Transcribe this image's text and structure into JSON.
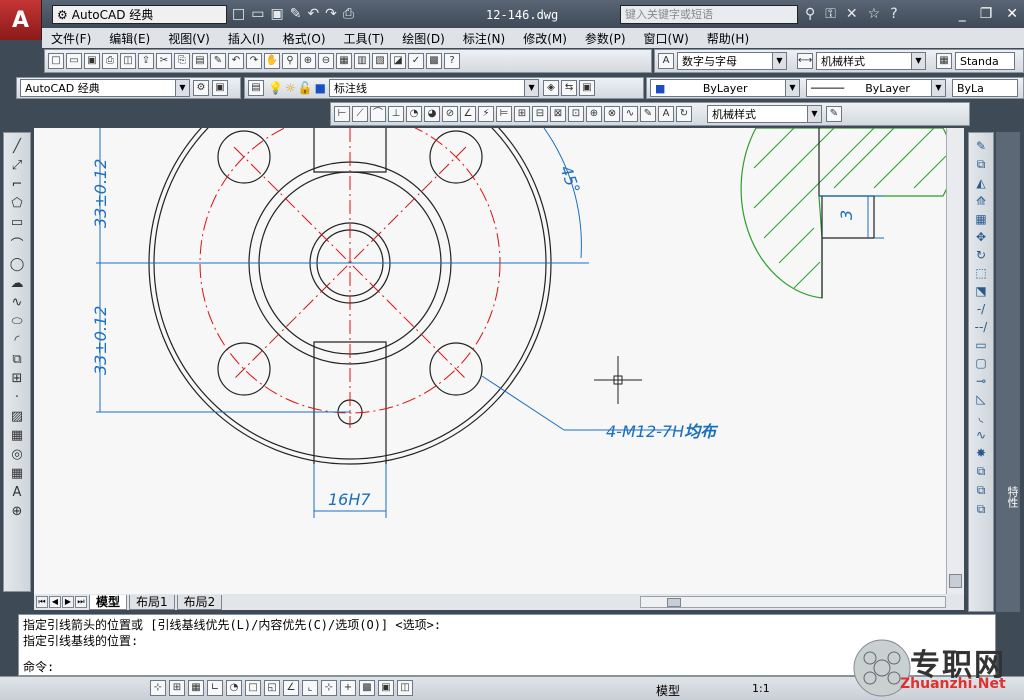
{
  "app": {
    "logo_letter": "A",
    "workspace": "AutoCAD 经典",
    "document_title": "12-146.dwg",
    "search_placeholder": "键入关键字或短语"
  },
  "menu": [
    "文件(F)",
    "编辑(E)",
    "视图(V)",
    "插入(I)",
    "格式(O)",
    "工具(T)",
    "绘图(D)",
    "标注(N)",
    "修改(M)",
    "参数(P)",
    "窗口(W)",
    "帮助(H)"
  ],
  "toolbar2": {
    "text_style": "数字与字母",
    "dim_style": "机械样式",
    "table_style": "Standa"
  },
  "toolbar3": {
    "workspace": "AutoCAD 经典",
    "layer": "标注线",
    "color": "ByLayer",
    "linetype": "ByLayer",
    "lineweight": "ByLa"
  },
  "toolbar4": {
    "dim_style": "机械样式"
  },
  "drawing": {
    "dim_upper": "33±0.12",
    "dim_lower": "33±0.12",
    "dim_angle": "45°",
    "dim_width": "16H7",
    "leader_text": "4-M12-7H",
    "leader_suffix": "均布",
    "detail_dim": "3"
  },
  "tabs": [
    "模型",
    "布局1",
    "布局2"
  ],
  "command": {
    "line1": "指定引线箭头的位置或 [引线基线优先(L)/内容优先(C)/选项(O)] <选项>:",
    "line2": "指定引线基线的位置:",
    "prompt": "命令:"
  },
  "status": {
    "model": "模型",
    "scale": "1:1"
  },
  "side_panel_label": "特性",
  "watermark": {
    "text": "专职网",
    "url": "Zhuanzhi.Net"
  },
  "colors": {
    "red": "#e01010",
    "blue": "#1a6fc0",
    "green": "#2aa02a"
  }
}
